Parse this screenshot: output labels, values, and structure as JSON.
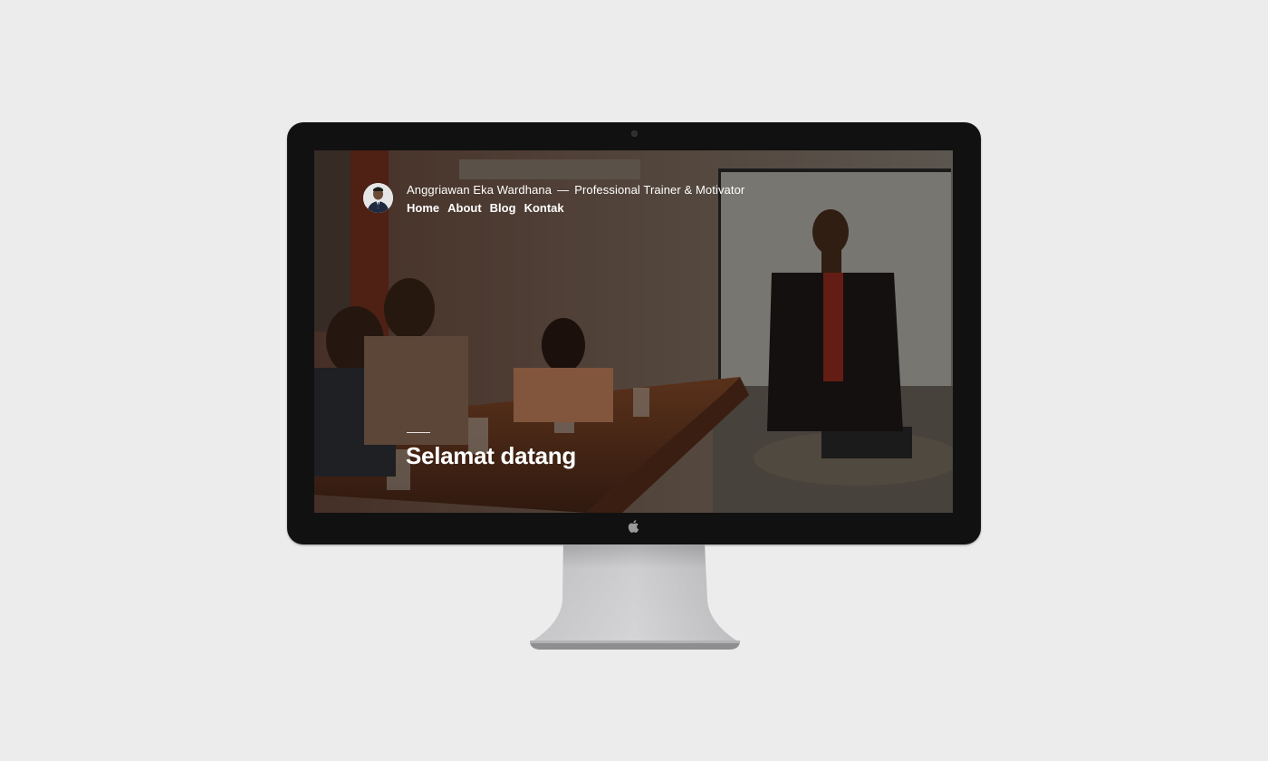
{
  "site": {
    "name": "Anggriawan Eka Wardhana",
    "separator": "—",
    "tagline": "Professional Trainer & Motivator"
  },
  "nav": {
    "items": [
      {
        "label": "Home"
      },
      {
        "label": "About"
      },
      {
        "label": "Blog"
      },
      {
        "label": "Kontak"
      }
    ]
  },
  "hero": {
    "title": "Selamat datang"
  },
  "colors": {
    "background": "#ececec",
    "bezel": "#111111",
    "text": "#ffffff"
  },
  "icons": {
    "camera": "camera-icon",
    "logo": "apple-logo-icon"
  }
}
